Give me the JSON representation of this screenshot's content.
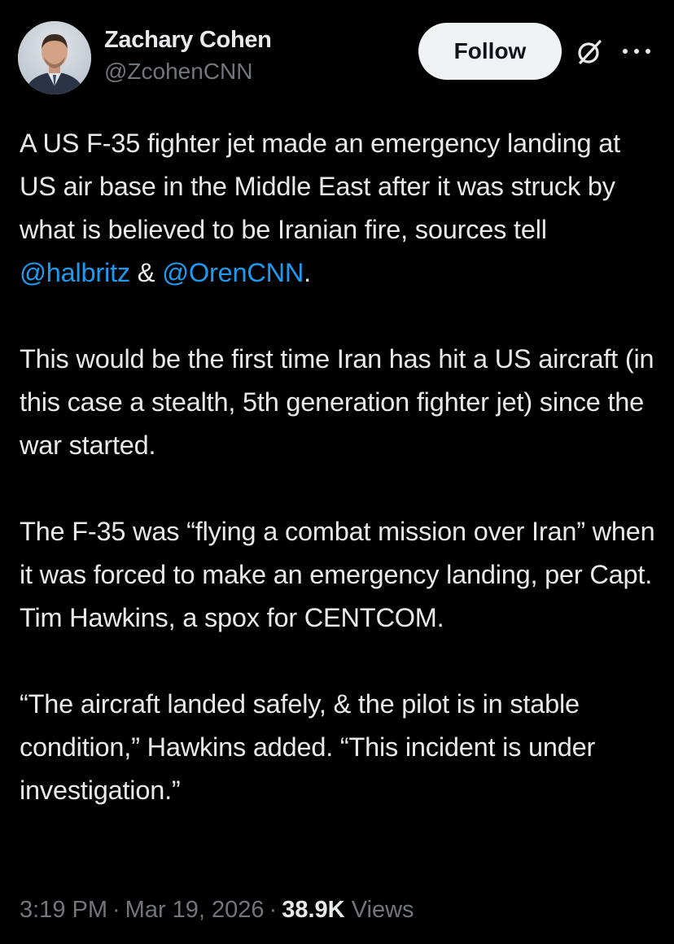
{
  "author": {
    "display_name": "Zachary Cohen",
    "handle": "@ZcohenCNN"
  },
  "actions": {
    "follow_label": "Follow",
    "grok_icon": "grok-slash-icon",
    "more_icon": "more-dots-icon"
  },
  "tweet": {
    "p1_a": "A US F-35 fighter jet made an emergency landing at US air base in the Middle East after it was struck by what is believed to be Iranian fire, sources tell ",
    "p1_mention1": "@halbritz",
    "p1_amp": " & ",
    "p1_mention2": "@OrenCNN",
    "p1_end": ".",
    "p2": "This would be the first time Iran has hit a US aircraft (in this case a stealth, 5th generation fighter jet) since the war started.",
    "p3": "The F-35 was “flying a combat mission over Iran” when it was forced to make an emergency landing, per Capt. Tim Hawkins, a spox for CENTCOM.",
    "p4": "“The aircraft landed safely, & the pilot is in stable condition,” Hawkins added. “This incident is under investigation.”"
  },
  "meta": {
    "time": "3:19 PM",
    "dot": "·",
    "date": "Mar 19, 2026",
    "views_count": "38.9K",
    "views_label": "Views"
  },
  "colors": {
    "background": "#000000",
    "text": "#e7e9ea",
    "muted": "#71767b",
    "link": "#1d9bf0",
    "button_bg": "#eff3f4"
  }
}
